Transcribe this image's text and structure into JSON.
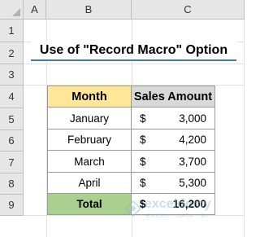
{
  "columns": [
    "A",
    "B",
    "C"
  ],
  "rows": [
    "1",
    "2",
    "3",
    "4",
    "5",
    "6",
    "7",
    "8",
    "9"
  ],
  "title": "Use of \"Record Macro\" Option",
  "table": {
    "headers": {
      "month": "Month",
      "sales": "Sales Amount"
    },
    "rows": [
      {
        "month": "January",
        "currency": "$",
        "amount": "3,000"
      },
      {
        "month": "February",
        "currency": "$",
        "amount": "4,200"
      },
      {
        "month": "March",
        "currency": "$",
        "amount": "3,700"
      },
      {
        "month": "April",
        "currency": "$",
        "amount": "5,300"
      }
    ],
    "total": {
      "label": "Total",
      "currency": "$",
      "amount": "16,200"
    }
  },
  "watermark": {
    "name": "exceldemy",
    "tagline": "EXCEL · DATA · BI"
  },
  "colors": {
    "month_header": "#ffe699",
    "sales_header": "#d9d9d9",
    "total_label": "#a9d08e",
    "title_underline": "#4a76b8"
  }
}
